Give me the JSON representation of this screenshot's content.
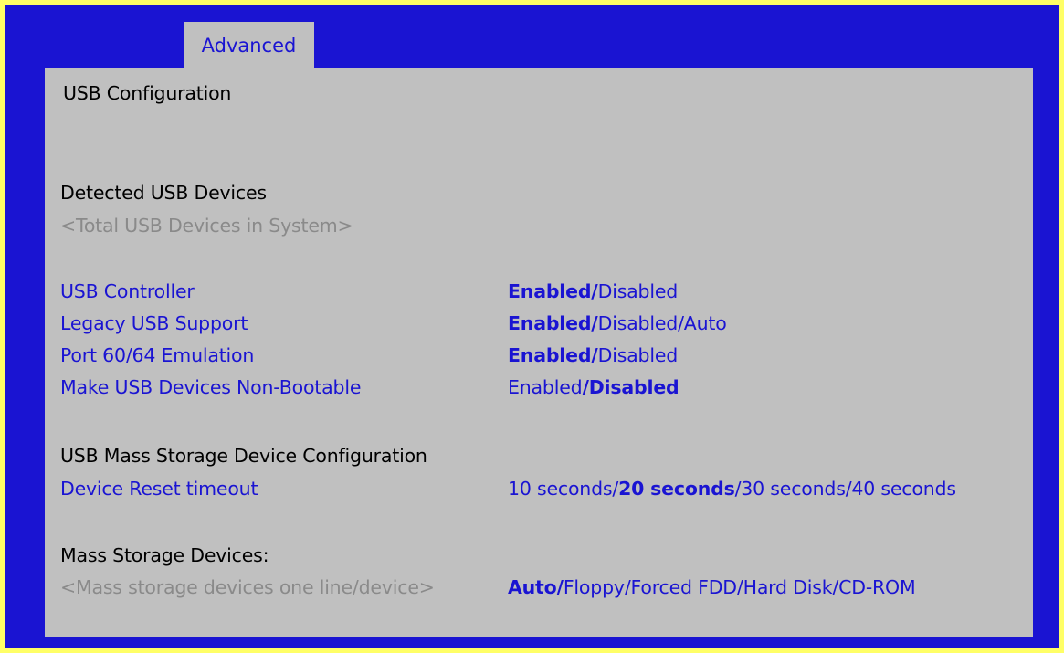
{
  "tab": {
    "label": "Advanced"
  },
  "page_title": "USB Configuration",
  "detected": {
    "heading": "Detected USB Devices",
    "total": "<Total USB Devices in System>"
  },
  "settings": [
    {
      "label": "USB Controller",
      "options": [
        {
          "text": "Enabled/",
          "bold": true
        },
        {
          "text": "Disabled",
          "bold": false
        }
      ]
    },
    {
      "label": "Legacy USB Support",
      "options": [
        {
          "text": "Enabled/",
          "bold": true
        },
        {
          "text": "Disabled/Auto",
          "bold": false
        }
      ]
    },
    {
      "label": "Port 60/64 Emulation",
      "options": [
        {
          "text": "Enabled/",
          "bold": true
        },
        {
          "text": "Disabled",
          "bold": false
        }
      ]
    },
    {
      "label": "Make USB Devices Non-Bootable",
      "options": [
        {
          "text": "Enabled",
          "bold": false
        },
        {
          "text": "/Disabled",
          "bold": true
        }
      ]
    }
  ],
  "mass_storage": {
    "heading": "USB Mass Storage Device Configuration",
    "reset_label": "Device Reset timeout",
    "reset_options": [
      {
        "text": "10 seconds/",
        "bold": false
      },
      {
        "text": "20 seconds",
        "bold": true
      },
      {
        "text": "/30 seconds/40 seconds",
        "bold": false
      }
    ],
    "devices_heading": "Mass Storage Devices:",
    "device_line": "<Mass storage devices one line/device>",
    "device_options": [
      {
        "text": "Auto/",
        "bold": true
      },
      {
        "text": "Floppy/Forced FDD/Hard Disk/CD-ROM",
        "bold": false
      }
    ]
  },
  "colors": {
    "frame_blue": "#1a14d2",
    "panel_grey": "#c0c0c0",
    "outer_yellow": "#ffff66",
    "help_grey": "#8a8a8a"
  }
}
